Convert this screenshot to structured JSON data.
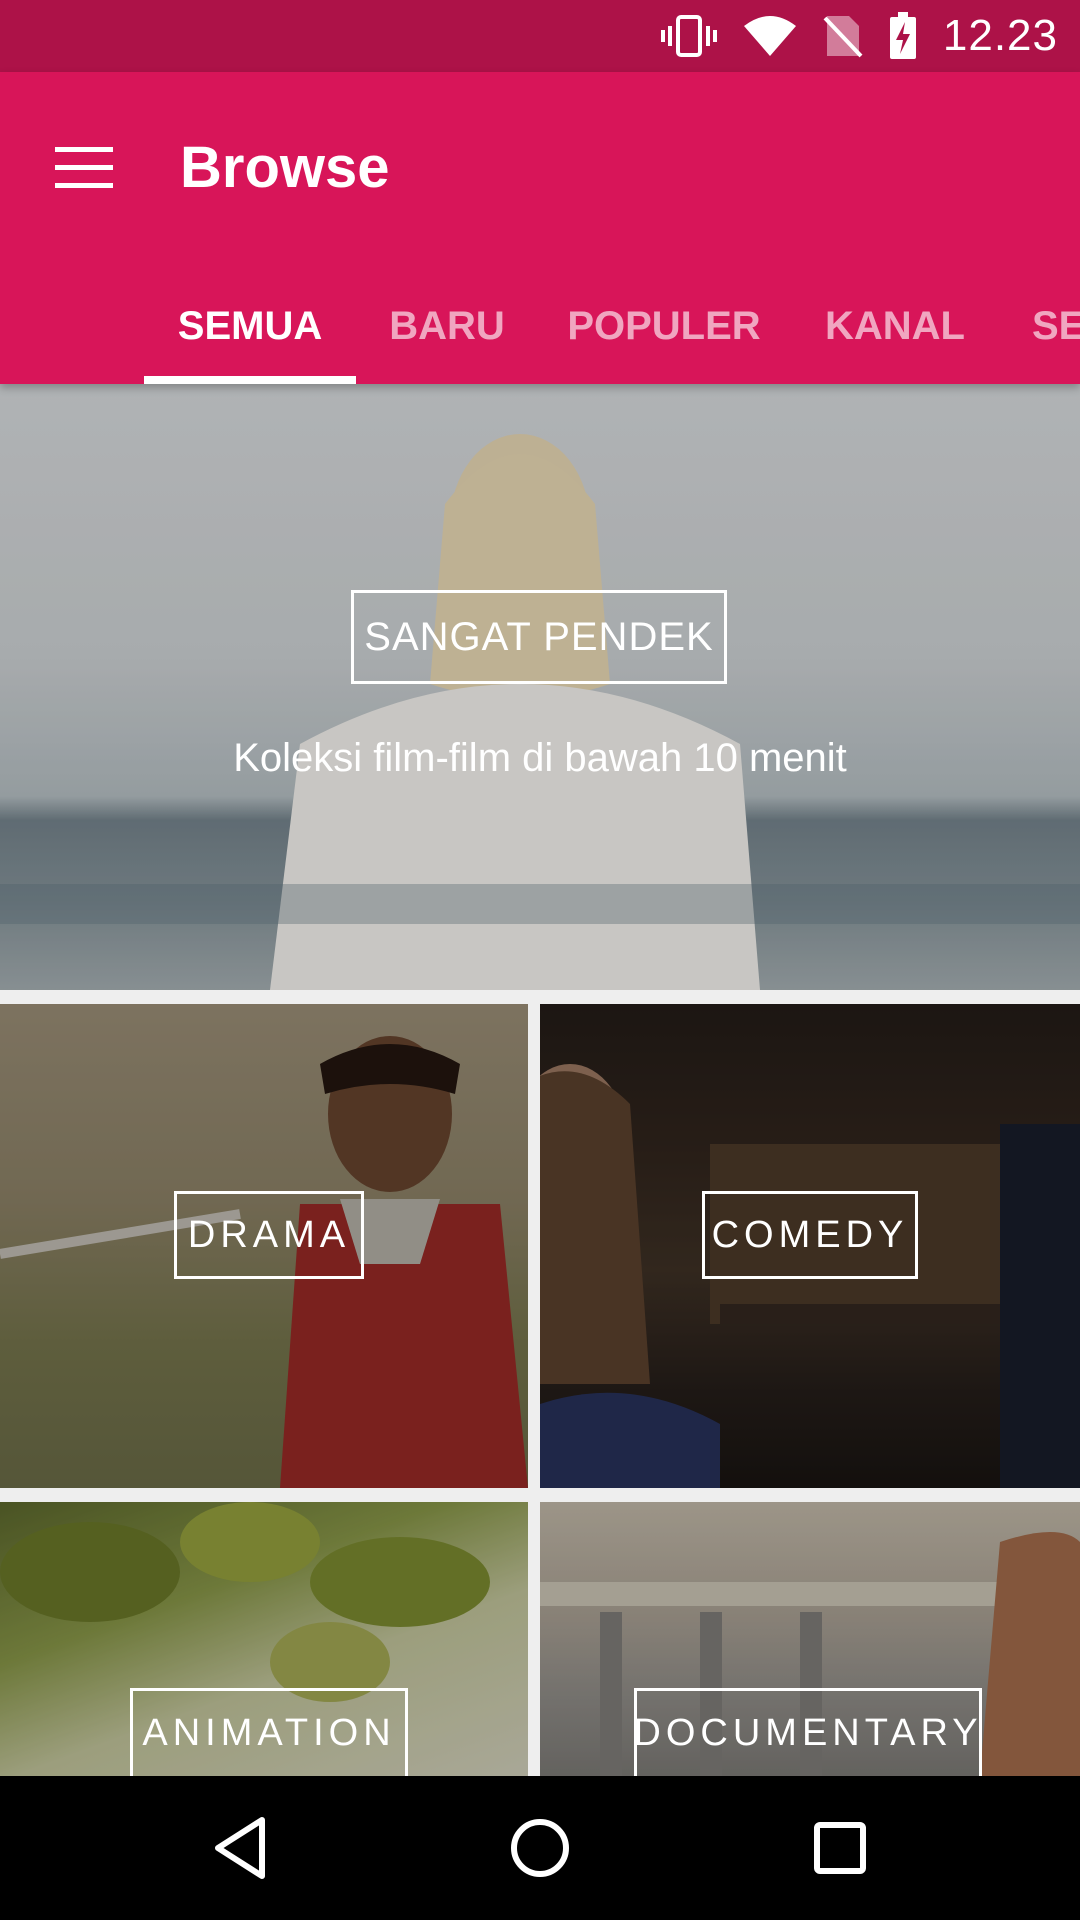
{
  "status_bar": {
    "time": "12.23",
    "icons": [
      "vibrate-icon",
      "wifi-icon",
      "no-sim-icon",
      "battery-charging-icon"
    ]
  },
  "app_bar": {
    "title": "Browse",
    "menu_icon": "menu-icon"
  },
  "tabs": [
    {
      "label": "SEMUA",
      "active": true
    },
    {
      "label": "BARU",
      "active": false
    },
    {
      "label": "POPULER",
      "active": false
    },
    {
      "label": "KANAL",
      "active": false
    },
    {
      "label": "SE",
      "active": false
    }
  ],
  "featured": {
    "label": "SANGAT PENDEK",
    "subtitle": "Koleksi film-film di bawah 10 menit"
  },
  "categories": [
    {
      "label": "DRAMA"
    },
    {
      "label": "COMEDY"
    },
    {
      "label": "ANIMATION"
    },
    {
      "label": "DOCUMENTARY"
    }
  ],
  "nav_bar": {
    "icons": [
      "back-icon",
      "home-icon",
      "recents-icon"
    ]
  },
  "colors": {
    "status_bar": "#ad1248",
    "app_bar": "#d81559",
    "tab_active": "#ffffff",
    "divider": "#eeeeee"
  }
}
